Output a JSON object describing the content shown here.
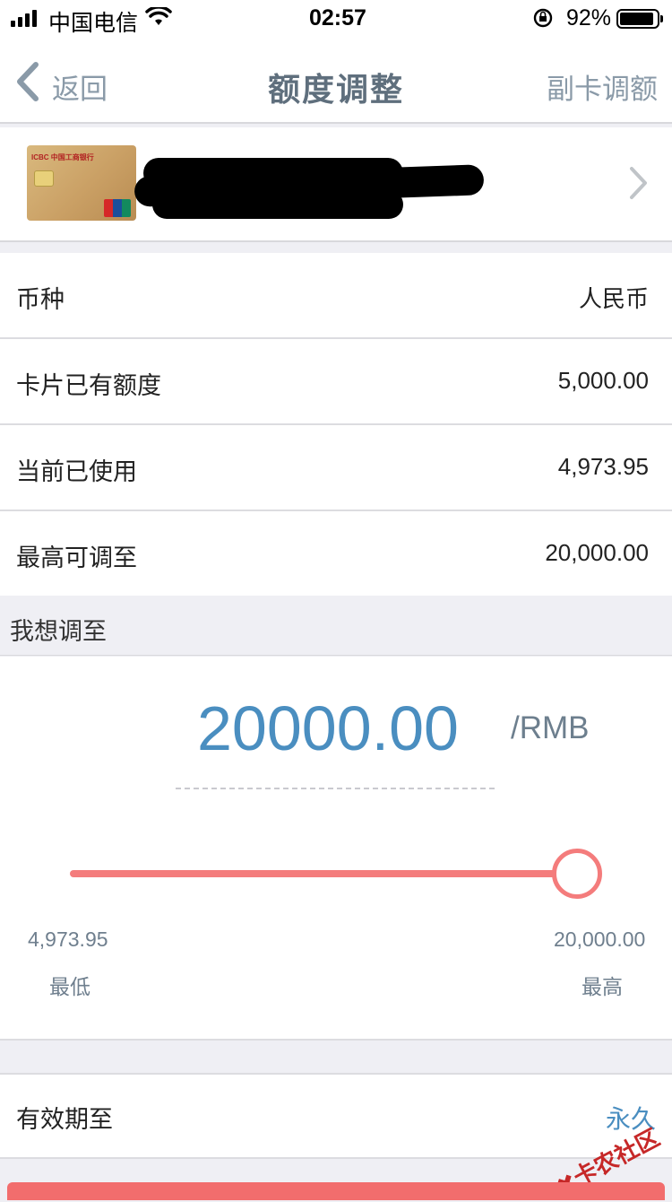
{
  "status_bar": {
    "carrier": "中国电信",
    "time": "02:57",
    "battery": "92%",
    "battery_level": 0.92
  },
  "nav": {
    "back_label": "返回",
    "title": "额度调整",
    "right_label": "副卡调额"
  },
  "card": {
    "bank_text": "ICBC 中国工商银行",
    "unionpay_text": "UnionPay 银联"
  },
  "rows": [
    {
      "label": "币种",
      "value": "人民币"
    },
    {
      "label": "卡片已有额度",
      "value": "5,000.00"
    },
    {
      "label": "当前已使用",
      "value": "4,973.95"
    },
    {
      "label": "最高可调至",
      "value": "20,000.00"
    }
  ],
  "adjust": {
    "section_label": "我想调至",
    "amount": "20000.00",
    "unit": "/RMB",
    "slider_fraction": 1.0,
    "min_value": "4,973.95",
    "min_label": "最低",
    "max_value": "20,000.00",
    "max_label": "最高"
  },
  "validity": {
    "label": "有效期至",
    "value": "永久"
  },
  "watermark": "卡农社区",
  "colors": {
    "accent_blue": "#4a8ec0",
    "slider_red": "#f47c7c",
    "nav_gray": "#5f6f7d"
  }
}
